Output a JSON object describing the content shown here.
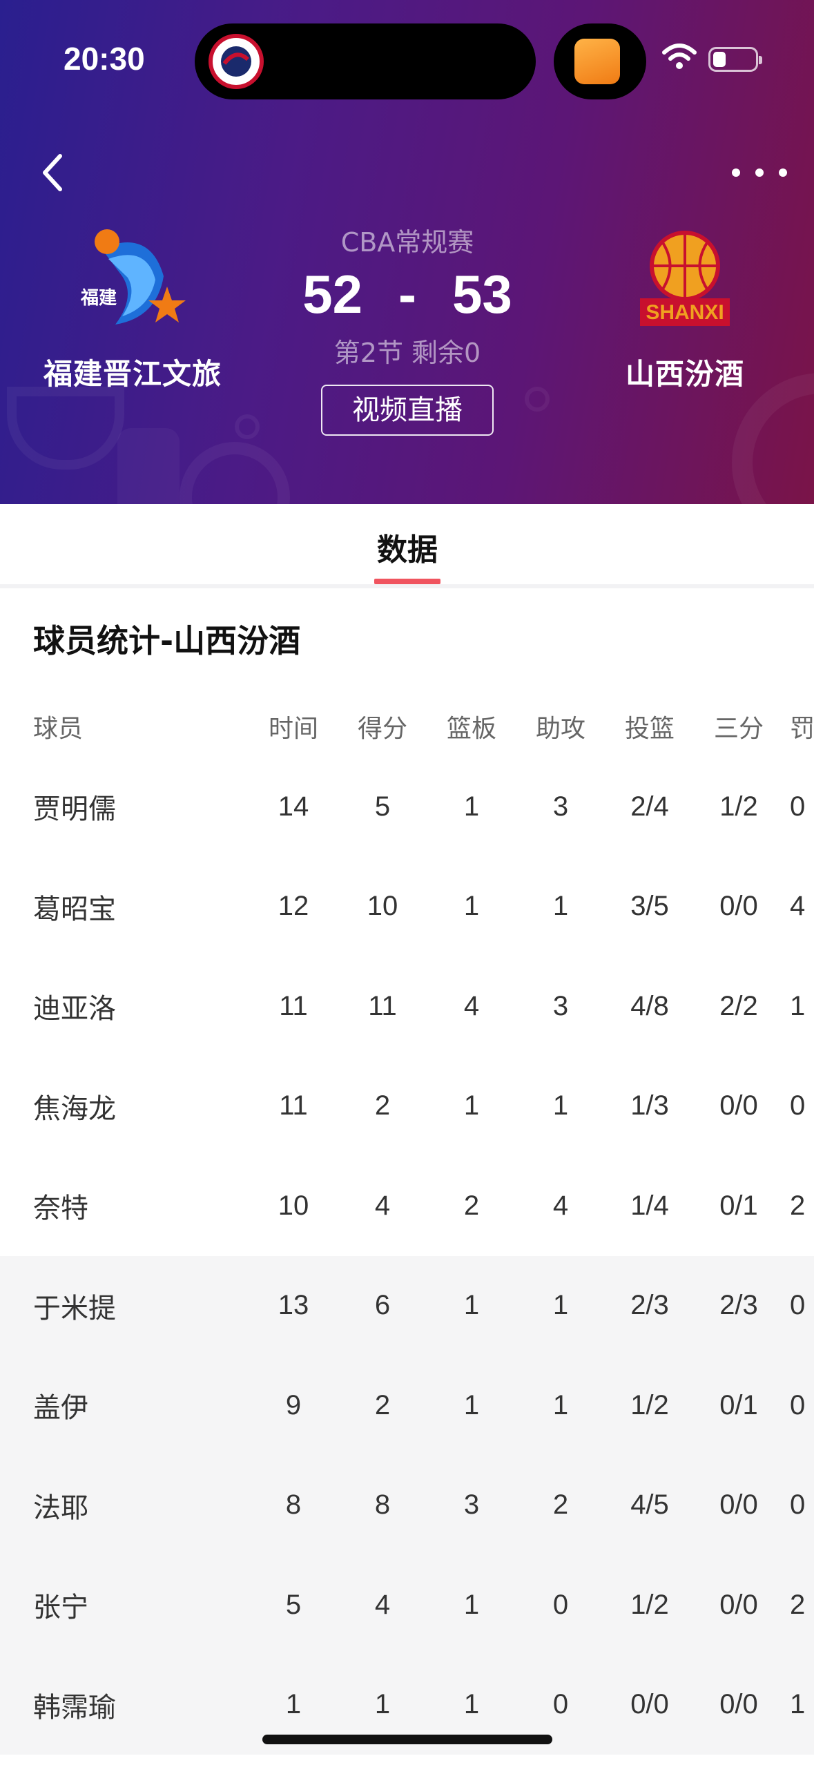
{
  "status_bar": {
    "time": "20:30"
  },
  "match": {
    "league": "CBA常规赛",
    "home_team": "福建晋江文旅",
    "away_team": "山西汾酒",
    "home_score": "52",
    "separator": "-",
    "away_score": "53",
    "period": "第2节 剩余0",
    "live_button": "视频直播"
  },
  "tabs": [
    {
      "label": "数据",
      "active": true
    }
  ],
  "stats": {
    "title": "球员统计-山西汾酒",
    "headers": [
      "球员",
      "时间",
      "得分",
      "篮板",
      "助攻",
      "投篮",
      "三分",
      "罚"
    ],
    "starters": [
      {
        "name": "贾明儒",
        "min": "14",
        "pts": "5",
        "reb": "1",
        "ast": "3",
        "fg": "2/4",
        "tp": "1/2",
        "ft": "0"
      },
      {
        "name": "葛昭宝",
        "min": "12",
        "pts": "10",
        "reb": "1",
        "ast": "1",
        "fg": "3/5",
        "tp": "0/0",
        "ft": "4"
      },
      {
        "name": "迪亚洛",
        "min": "11",
        "pts": "11",
        "reb": "4",
        "ast": "3",
        "fg": "4/8",
        "tp": "2/2",
        "ft": "1"
      },
      {
        "name": "焦海龙",
        "min": "11",
        "pts": "2",
        "reb": "1",
        "ast": "1",
        "fg": "1/3",
        "tp": "0/0",
        "ft": "0"
      },
      {
        "name": "奈特",
        "min": "10",
        "pts": "4",
        "reb": "2",
        "ast": "4",
        "fg": "1/4",
        "tp": "0/1",
        "ft": "2"
      }
    ],
    "bench": [
      {
        "name": "于米提",
        "min": "13",
        "pts": "6",
        "reb": "1",
        "ast": "1",
        "fg": "2/3",
        "tp": "2/3",
        "ft": "0"
      },
      {
        "name": "盖伊",
        "min": "9",
        "pts": "2",
        "reb": "1",
        "ast": "1",
        "fg": "1/2",
        "tp": "0/1",
        "ft": "0"
      },
      {
        "name": "法耶",
        "min": "8",
        "pts": "8",
        "reb": "3",
        "ast": "2",
        "fg": "4/5",
        "tp": "0/0",
        "ft": "0"
      },
      {
        "name": "张宁",
        "min": "5",
        "pts": "4",
        "reb": "1",
        "ast": "0",
        "fg": "1/2",
        "tp": "0/0",
        "ft": "2"
      },
      {
        "name": "韩霈瑜",
        "min": "1",
        "pts": "1",
        "reb": "1",
        "ast": "0",
        "fg": "0/0",
        "tp": "0/0",
        "ft": "1"
      }
    ]
  },
  "colors": {
    "tab_indicator": "#f0545f",
    "header_gradient_start": "#2a1f8f",
    "header_gradient_end": "#7a1448"
  }
}
